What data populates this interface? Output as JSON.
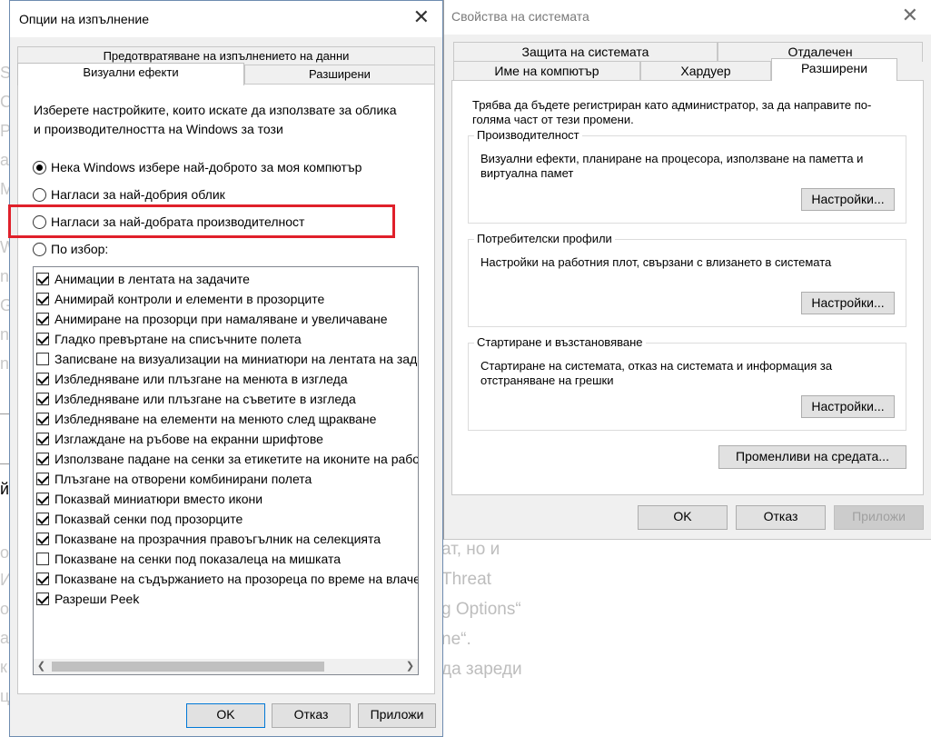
{
  "background": {
    "lines": [
      "ат, но и",
      "Threat",
      "g Options“",
      "ne“.",
      "да зареди"
    ],
    "edge_chars": [
      "S",
      "С",
      "P",
      "a",
      "M",
      "W",
      "n",
      "G",
      "n",
      "n",
      "о",
      "И",
      "о",
      "а",
      "к",
      "ц"
    ],
    "left_fragment": "й"
  },
  "system_properties": {
    "title": "Свойства на системата",
    "tabs_top": [
      "Защита на системата",
      "Отдалечен"
    ],
    "tabs_bottom": [
      "Име на компютър",
      "Хардуер",
      "Разширени"
    ],
    "intro": "Трябва да бъдете регистриран като администратор, за да направите по-голяма част от тези промени.",
    "groups": [
      {
        "title": "Производителност",
        "desc": "Визуални ефекти, планиране на процесора, използване на паметта и виртуална памет",
        "button": "Настройки..."
      },
      {
        "title": "Потребителски профили",
        "desc": "Настройки на работния плот, свързани с влизането в системата",
        "button": "Настройки..."
      },
      {
        "title": "Стартиране и възстановяване",
        "desc": "Стартиране на системата, отказ на системата и информация за отстраняване на грешки",
        "button": "Настройки..."
      }
    ],
    "env_button": "Променливи на средата...",
    "ok": "OK",
    "cancel": "Отказ",
    "apply": "Приложи"
  },
  "performance_options": {
    "title": "Опции на изпълнение",
    "tab_top": "Предотвратяване на изпълнението на данни",
    "tabs_bottom": [
      "Визуални ефекти",
      "Разширени"
    ],
    "intro": "Изберете настройките, които искате да използвате за облика и производителността на Windows за този",
    "radios": [
      {
        "label": "Нека Windows избере най-доброто за моя компютър",
        "selected": true
      },
      {
        "label": "Нагласи за най-добрия облик",
        "selected": false
      },
      {
        "label": "Нагласи за най-добрата производителност",
        "selected": false
      },
      {
        "label": "По избор:",
        "selected": false
      }
    ],
    "effects": [
      {
        "label": "Анимации в лентата на задачите",
        "checked": true
      },
      {
        "label": "Анимирай контроли и елементи в прозорците",
        "checked": true
      },
      {
        "label": "Анимиране на прозорци при намаляване и увеличаване",
        "checked": true
      },
      {
        "label": "Гладко превъртане на списъчните полета",
        "checked": true
      },
      {
        "label": "Записване на визуализации на миниатюри на лентата на задачите",
        "checked": false
      },
      {
        "label": "Избледняване или плъзгане на менюта в изгледа",
        "checked": true
      },
      {
        "label": "Избледняване или плъзгане на съветите в изгледа",
        "checked": true
      },
      {
        "label": "Избледняване на елементи на менюто след щракване",
        "checked": true
      },
      {
        "label": "Изглаждане на ръбове на екранни шрифтове",
        "checked": true
      },
      {
        "label": "Използване падане на сенки за етикетите на иконите на работния плот",
        "checked": true
      },
      {
        "label": "Плъзгане на отворени комбинирани полета",
        "checked": true
      },
      {
        "label": "Показвай миниатюри вместо икони",
        "checked": true
      },
      {
        "label": "Показвай сенки под прозорците",
        "checked": true
      },
      {
        "label": "Показване на прозрачния правоъгълник на селекцията",
        "checked": true
      },
      {
        "label": "Показване на сенки под показалеца на мишката",
        "checked": false
      },
      {
        "label": "Показване на съдържанието на прозореца по време на влачене",
        "checked": true
      },
      {
        "label": "Разреши Peek",
        "checked": true
      }
    ],
    "ok": "OK",
    "cancel": "Отказ",
    "apply": "Приложи"
  }
}
